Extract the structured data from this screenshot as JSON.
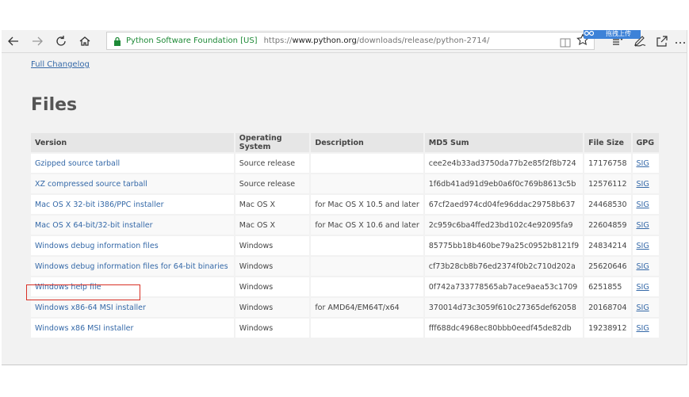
{
  "browser": {
    "cert_label": "Python Software Foundation [US]",
    "url_prefix": "https://",
    "url_domain": "www.python.org",
    "url_path": "/downloads/release/python-2714/",
    "extension_label": "拖拽上传"
  },
  "page": {
    "changelog_link": "Full Changelog",
    "files_heading": "Files"
  },
  "table": {
    "headers": [
      "Version",
      "Operating System",
      "Description",
      "MD5 Sum",
      "File Size",
      "GPG"
    ],
    "rows": [
      {
        "version": "Gzipped source tarball",
        "os": "Source release",
        "desc": "",
        "md5": "cee2e4b33ad3750da77b2e85f2f8b724",
        "size": "17176758",
        "gpg": "SIG"
      },
      {
        "version": "XZ compressed source tarball",
        "os": "Source release",
        "desc": "",
        "md5": "1f6db41ad91d9eb0a6f0c769b8613c5b",
        "size": "12576112",
        "gpg": "SIG"
      },
      {
        "version": "Mac OS X 32-bit i386/PPC installer",
        "os": "Mac OS X",
        "desc": "for Mac OS X 10.5 and later",
        "md5": "67cf2aed974cd04fe96ddac29758b637",
        "size": "24468530",
        "gpg": "SIG"
      },
      {
        "version": "Mac OS X 64-bit/32-bit installer",
        "os": "Mac OS X",
        "desc": "for Mac OS X 10.6 and later",
        "md5": "2c959c6ba4ffed23bd102c4e92095fa9",
        "size": "22604859",
        "gpg": "SIG"
      },
      {
        "version": "Windows debug information files",
        "os": "Windows",
        "desc": "",
        "md5": "85775bb18b460be79a25c0952b8121f9",
        "size": "24834214",
        "gpg": "SIG"
      },
      {
        "version": "Windows debug information files for 64-bit binaries",
        "os": "Windows",
        "desc": "",
        "md5": "cf73b28cb8b76ed2374f0b2c710d202a",
        "size": "25620646",
        "gpg": "SIG"
      },
      {
        "version": "Windows help file",
        "os": "Windows",
        "desc": "",
        "md5": "0f742a733778565ab7ace9aea53c1709",
        "size": "6251855",
        "gpg": "SIG"
      },
      {
        "version": "Windows x86-64 MSI installer",
        "os": "Windows",
        "desc": "for AMD64/EM64T/x64",
        "md5": "370014d73c3059f610c27365def62058",
        "size": "20168704",
        "gpg": "SIG"
      },
      {
        "version": "Windows x86 MSI installer",
        "os": "Windows",
        "desc": "",
        "md5": "fff688dc4968ec80bbb0eedf45de82db",
        "size": "19238912",
        "gpg": "SIG"
      }
    ]
  },
  "colors": {
    "link": "#3569a8",
    "highlight": "#d93025",
    "cert_green": "#1e8a37"
  }
}
